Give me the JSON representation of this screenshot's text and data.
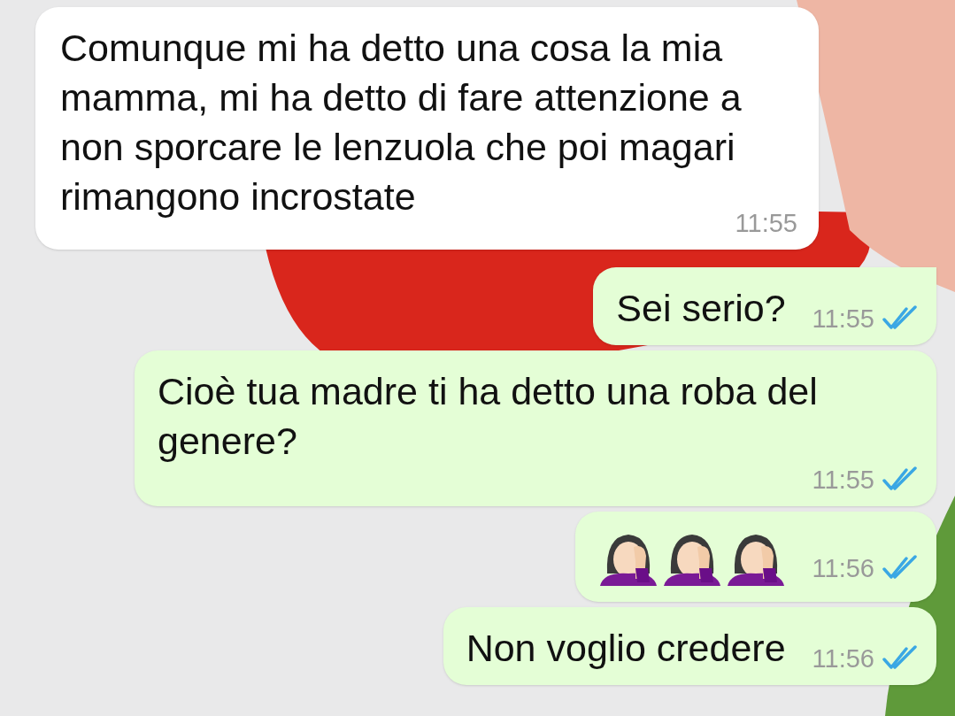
{
  "messages": [
    {
      "kind": "incoming",
      "text": "Comunque mi ha detto una cosa la mia mamma, mi ha detto di fare attenzione a non sporcare le lenzuola che poi magari rimangono incrostate",
      "time": "11:55"
    },
    {
      "kind": "outgoing",
      "text": "Sei serio?",
      "time": "11:55",
      "read": true
    },
    {
      "kind": "outgoing",
      "text": "Cioè tua madre ti ha detto una roba del genere?",
      "time": "11:55",
      "read": true
    },
    {
      "kind": "outgoing",
      "emojis": [
        {
          "kind": "facepalm"
        },
        {
          "kind": "facepalm"
        },
        {
          "kind": "facepalm"
        }
      ],
      "time": "11:56",
      "read": true
    },
    {
      "kind": "outgoing",
      "text": "Non voglio credere",
      "time": "11:56",
      "read": true
    }
  ]
}
